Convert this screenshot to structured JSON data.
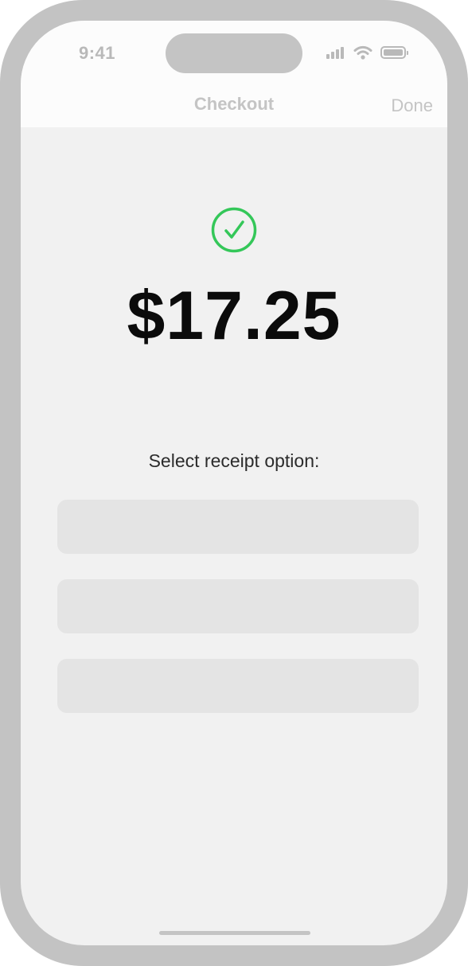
{
  "status_bar": {
    "time": "9:41",
    "icons": [
      "signal-icon",
      "wifi-icon",
      "battery-icon"
    ]
  },
  "nav": {
    "title": "Checkout",
    "done_label": "Done"
  },
  "payment": {
    "status_icon": "checkmark-circle-icon",
    "amount": "$17.25",
    "accent_color": "#34c759"
  },
  "receipt": {
    "prompt": "Select receipt option:",
    "options": [
      {
        "label": ""
      },
      {
        "label": ""
      },
      {
        "label": ""
      }
    ]
  }
}
